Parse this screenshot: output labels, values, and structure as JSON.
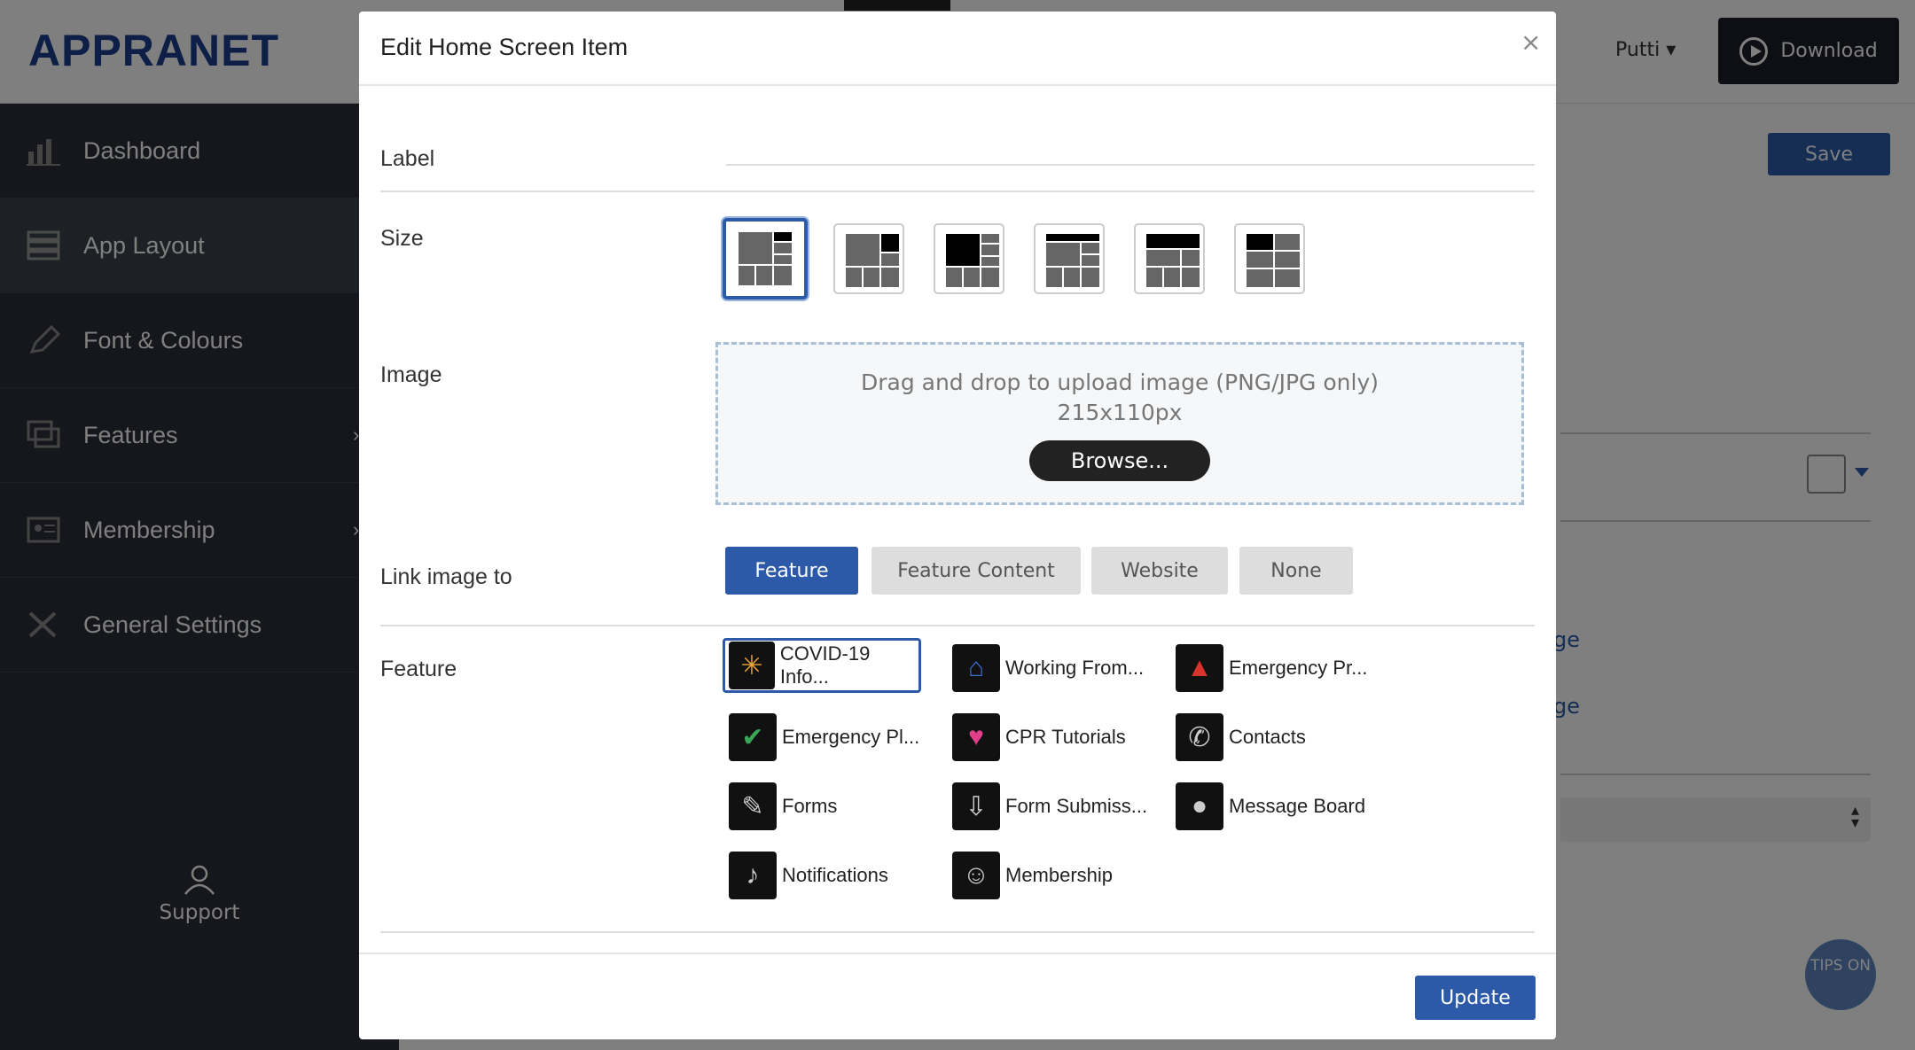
{
  "app": {
    "logo": "APPRANET",
    "user": "Putti",
    "download_label": "Download"
  },
  "sidebar": {
    "items": [
      {
        "label": "Dashboard",
        "icon": "bar-chart-icon"
      },
      {
        "label": "App Layout",
        "icon": "layout-icon"
      },
      {
        "label": "Font & Colours",
        "icon": "pencil-icon"
      },
      {
        "label": "Features",
        "icon": "screens-icon"
      },
      {
        "label": "Membership",
        "icon": "id-card-icon"
      },
      {
        "label": "General Settings",
        "icon": "tools-icon"
      }
    ],
    "support_label": "Support"
  },
  "main": {
    "save_label": "Save",
    "link1": "ge",
    "link2": "ge",
    "tips_label": "TIPS ON"
  },
  "modal": {
    "title": "Edit Home Screen Item",
    "close": "×",
    "label_field": {
      "label": "Label",
      "value": ""
    },
    "size": {
      "label": "Size",
      "selected_index": 0,
      "option_count": 6
    },
    "image": {
      "label": "Image",
      "drop_text": "Drag and drop to upload image (PNG/JPG only)",
      "dims": "215x110px",
      "browse_label": "Browse..."
    },
    "link_image": {
      "label": "Link image to",
      "options": [
        "Feature",
        "Feature Content",
        "Website",
        "None"
      ],
      "selected": "Feature"
    },
    "feature": {
      "label": "Feature",
      "items": [
        {
          "label": "COVID-19 Info...",
          "icon": "virus-icon",
          "color": "#e8a23a"
        },
        {
          "label": "Working From...",
          "icon": "home-icon",
          "color": "#3b6fd6"
        },
        {
          "label": "Emergency Pr...",
          "icon": "warning-icon",
          "color": "#d9342b"
        },
        {
          "label": "Emergency Pl...",
          "icon": "shield-check-icon",
          "color": "#3aa655"
        },
        {
          "label": "CPR Tutorials",
          "icon": "heart-icon",
          "color": "#e0408a"
        },
        {
          "label": "Contacts",
          "icon": "phone-icon",
          "color": "#cccccc"
        },
        {
          "label": "Forms",
          "icon": "edit-form-icon",
          "color": "#cccccc"
        },
        {
          "label": "Form Submiss...",
          "icon": "inbox-icon",
          "color": "#cccccc"
        },
        {
          "label": "Message Board",
          "icon": "chat-bubble-icon",
          "color": "#cccccc"
        },
        {
          "label": "Notifications",
          "icon": "bell-icon",
          "color": "#cccccc"
        },
        {
          "label": "Membership",
          "icon": "user-circle-icon",
          "color": "#cccccc"
        }
      ],
      "selected": "COVID-19 Info..."
    },
    "update_label": "Update"
  }
}
